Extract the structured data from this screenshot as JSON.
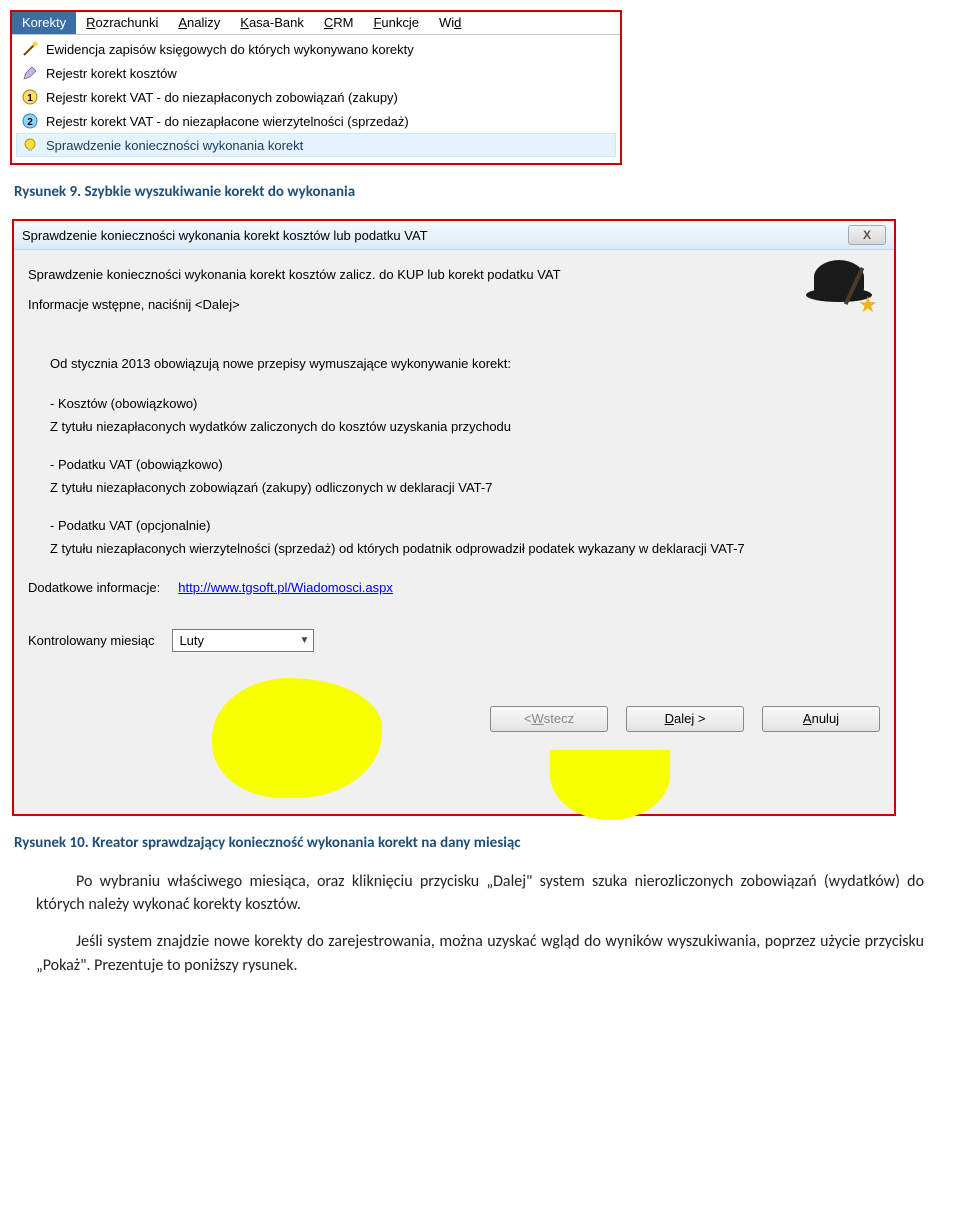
{
  "menubar": {
    "items": [
      "Korekty",
      "Rozrachunki",
      "Analizy",
      "Kasa-Bank",
      "CRM",
      "Funkcje",
      "Wid"
    ],
    "underline_idx": [
      0,
      0,
      0,
      0,
      0,
      0,
      2
    ],
    "selected": 0
  },
  "dropdown": {
    "items": [
      {
        "icon": "wand",
        "label": "Ewidencja zapisów księgowych do których wykonywano korekty"
      },
      {
        "icon": "pencil",
        "label": "Rejestr korekt kosztów"
      },
      {
        "icon": "badge1",
        "label": "Rejestr korekt VAT - do niezapłaconych zobowiązań  (zakupy)"
      },
      {
        "icon": "badge2",
        "label": "Rejestr korekt VAT - do niezapłacone wierzytelności  (sprzedaż)"
      },
      {
        "icon": "bulb",
        "label": "Sprawdzenie konieczności wykonania korekt",
        "hover": true
      }
    ]
  },
  "fig1": {
    "prefix": "Rysunek 9.",
    "text": " Szybkie wyszukiwanie korekt do wykonania"
  },
  "dialog": {
    "title": "Sprawdzenie konieczności wykonania korekt kosztów lub podatku VAT",
    "close": "X",
    "header1": "Sprawdzenie konieczności wykonania korekt kosztów zalicz. do KUP lub korekt podatku VAT",
    "header2": "Informacje wstępne, naciśnij <Dalej>",
    "intro": "Od stycznia 2013 obowiązują nowe przepisy wymuszające wykonywanie korekt:",
    "b1a": "- Kosztów (obowiązkowo)",
    "b1b": "Z tytułu niezapłaconych wydatków zaliczonych do kosztów uzyskania przychodu",
    "b2a": "- Podatku VAT (obowiązkowo)",
    "b2b": "Z tytułu niezapłaconych zobowiązań (zakupy) odliczonych w deklaracji VAT-7",
    "b3a": "- Podatku VAT (opcjonalnie)",
    "b3b": "Z tytułu niezapłaconych wierzytelności (sprzedaż) od których podatnik odprowadził podatek wykazany w deklaracji VAT-7",
    "extra_label": "Dodatkowe informacje:",
    "extra_link": "http://www.tgsoft.pl/Wiadomosci.aspx",
    "month_label": "Kontrolowany miesiąc",
    "month_value": "Luty",
    "btn_back": "< Wstecz",
    "btn_next": "Dalej >",
    "btn_cancel": "Anuluj"
  },
  "fig2": {
    "prefix": "Rysunek 10.",
    "text": " Kreator sprawdzający konieczność  wykonania korekt na dany miesiąc"
  },
  "para1": "Po wybraniu właściwego miesiąca, oraz kliknięciu przycisku „Dalej\" system szuka nierozliczonych zobowiązań (wydatków) do których należy wykonać korekty kosztów.",
  "para2": "Jeśli system znajdzie nowe korekty do zarejestrowania, można uzyskać wgląd do wyników wyszukiwania, poprzez użycie przycisku „Pokaż\". Prezentuje to poniższy rysunek."
}
